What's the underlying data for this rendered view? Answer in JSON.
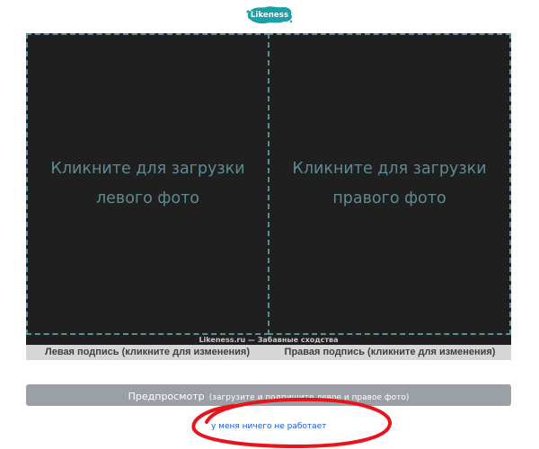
{
  "logo": {
    "text": "Likeness",
    "color": "#1aa0a6"
  },
  "upload": {
    "left_prompt": "Кликните для загрузки\nлевого фото",
    "right_prompt": "Кликните для загрузки\nправого фото"
  },
  "watermark": "Likeness.ru — Забавные сходства",
  "captions": {
    "left": "Левая подпись (кликните для изменения)",
    "right": "Правая подпись (кликните для изменения)"
  },
  "preview_button": {
    "label": "Предпросмотр",
    "hint": "(загрузите и подпишите левое и правое фото)"
  },
  "help_link": "у меня ничего не работает",
  "annotation": {
    "color": "#e8141b",
    "shape": "hand-drawn ellipse"
  }
}
